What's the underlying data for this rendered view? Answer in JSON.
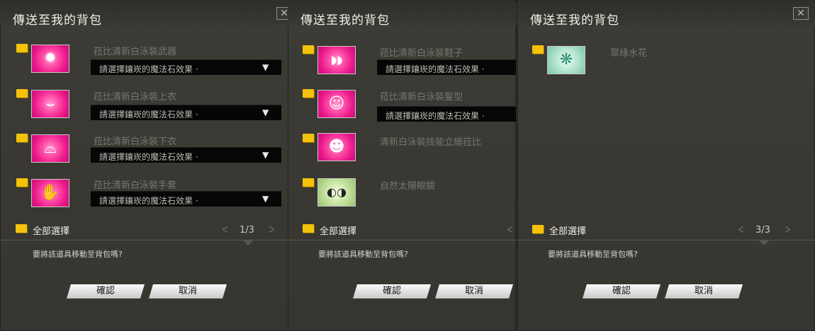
{
  "panels": [
    {
      "title": "傳送至我的背包",
      "close": "✕",
      "items": [
        {
          "name": "菈比清新白泳裝武器",
          "dropdown": "請選擇鑲崁的魔法石效果 ·",
          "glyph": "✹"
        },
        {
          "name": "菈比清新白泳裝上衣",
          "dropdown": "請選擇鑲崁的魔法石效果 ·",
          "glyph": "⌣"
        },
        {
          "name": "菈比清新白泳裝下衣",
          "dropdown": "請選擇鑲崁的魔法石效果 ·",
          "glyph": "⌓"
        },
        {
          "name": "菈比清新白泳裝手套",
          "dropdown": "請選擇鑲崁的魔法石效果 ·",
          "glyph": "✋"
        }
      ],
      "select_all": "全部選擇",
      "pager": "1/3",
      "question": "要將該道具移動至背包嗎?",
      "confirm": "確認",
      "cancel": "取消"
    },
    {
      "title": "傳送至我的背包",
      "items": [
        {
          "name": "菈比清新白泳裝鞋子",
          "dropdown": "請選擇鑲崁的魔法石效果 ·",
          "glyph": "◗◗"
        },
        {
          "name": "菈比清新白泳裝髮型",
          "dropdown": "請選擇鑲崁的魔法石效果 ·",
          "glyph": "☺"
        },
        {
          "name": "清新白泳裝技能立繪菈比",
          "glyph": "☻"
        },
        {
          "name": "自然太陽眼鏡",
          "glyph": "◐◑"
        }
      ],
      "select_all": "全部選擇",
      "question": "要將該道具移動至背包嗎?",
      "confirm": "確認",
      "cancel": "取消"
    },
    {
      "title": "傳送至我的背包",
      "close": "✕",
      "items": [
        {
          "name": "翠綠水花",
          "glyph": "❋"
        }
      ],
      "select_all": "全部選擇",
      "pager": "3/3",
      "question": "要將該道具移動至背包嗎?",
      "confirm": "確認",
      "cancel": "取消"
    }
  ],
  "icons": {
    "pager_prev": "<",
    "pager_next": ">",
    "dropdown_arrow": "▼"
  },
  "colors": {
    "checkbox": "#f4c20b",
    "thumb_pink": "#e9198a",
    "thumb_green": "#97c46e"
  }
}
